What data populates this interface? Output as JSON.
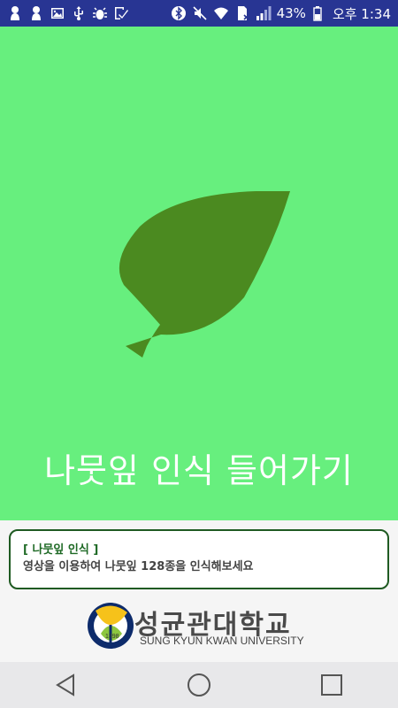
{
  "status_bar": {
    "battery": "43%",
    "time": "오후 1:34"
  },
  "hero": {
    "enter_label": "나뭇잎 인식 들어가기",
    "background_color": "#67ef7e",
    "leaf_color": "#4b8a20"
  },
  "info_card": {
    "title": "[ 나뭇잎 인식 ]",
    "description": "영상을 이용하여 나뭇잎 128종을 인식해보세요"
  },
  "university": {
    "name_ko": "성균관대학교",
    "name_en": "SUNG KYUN KWAN UNIVERSITY",
    "year": "1398"
  },
  "nav": {
    "back": "back-icon",
    "home": "home-icon",
    "recents": "recents-icon"
  }
}
